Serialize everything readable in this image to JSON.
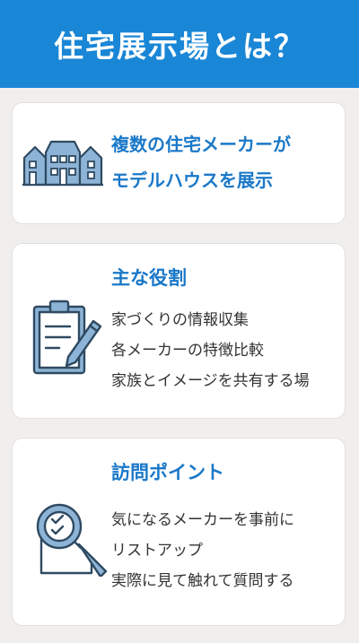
{
  "header": {
    "title": "住宅展示場とは？"
  },
  "card1": {
    "icon": "houses-icon",
    "line1": "複数の住宅メーカーが",
    "line2": "モデルハウスを展示"
  },
  "card2": {
    "icon": "clipboard-pencil-icon",
    "title": "主な役割",
    "items": [
      "家づくりの情報収集",
      "各メーカーの特徴比較",
      "家族とイメージを共有する場"
    ]
  },
  "card3": {
    "icon": "magnifier-checklist-icon",
    "title": "訪問ポイント",
    "items": [
      "気になるメーカーを事前に",
      "リストアップ",
      "実際に見て触れて質問する"
    ]
  },
  "colors": {
    "header_bg": "#1a86d6",
    "accent_text": "#1a78c8",
    "icon_fill": "#8db4d6",
    "icon_stroke": "#2f4a62",
    "page_bg": "#f1efee"
  }
}
